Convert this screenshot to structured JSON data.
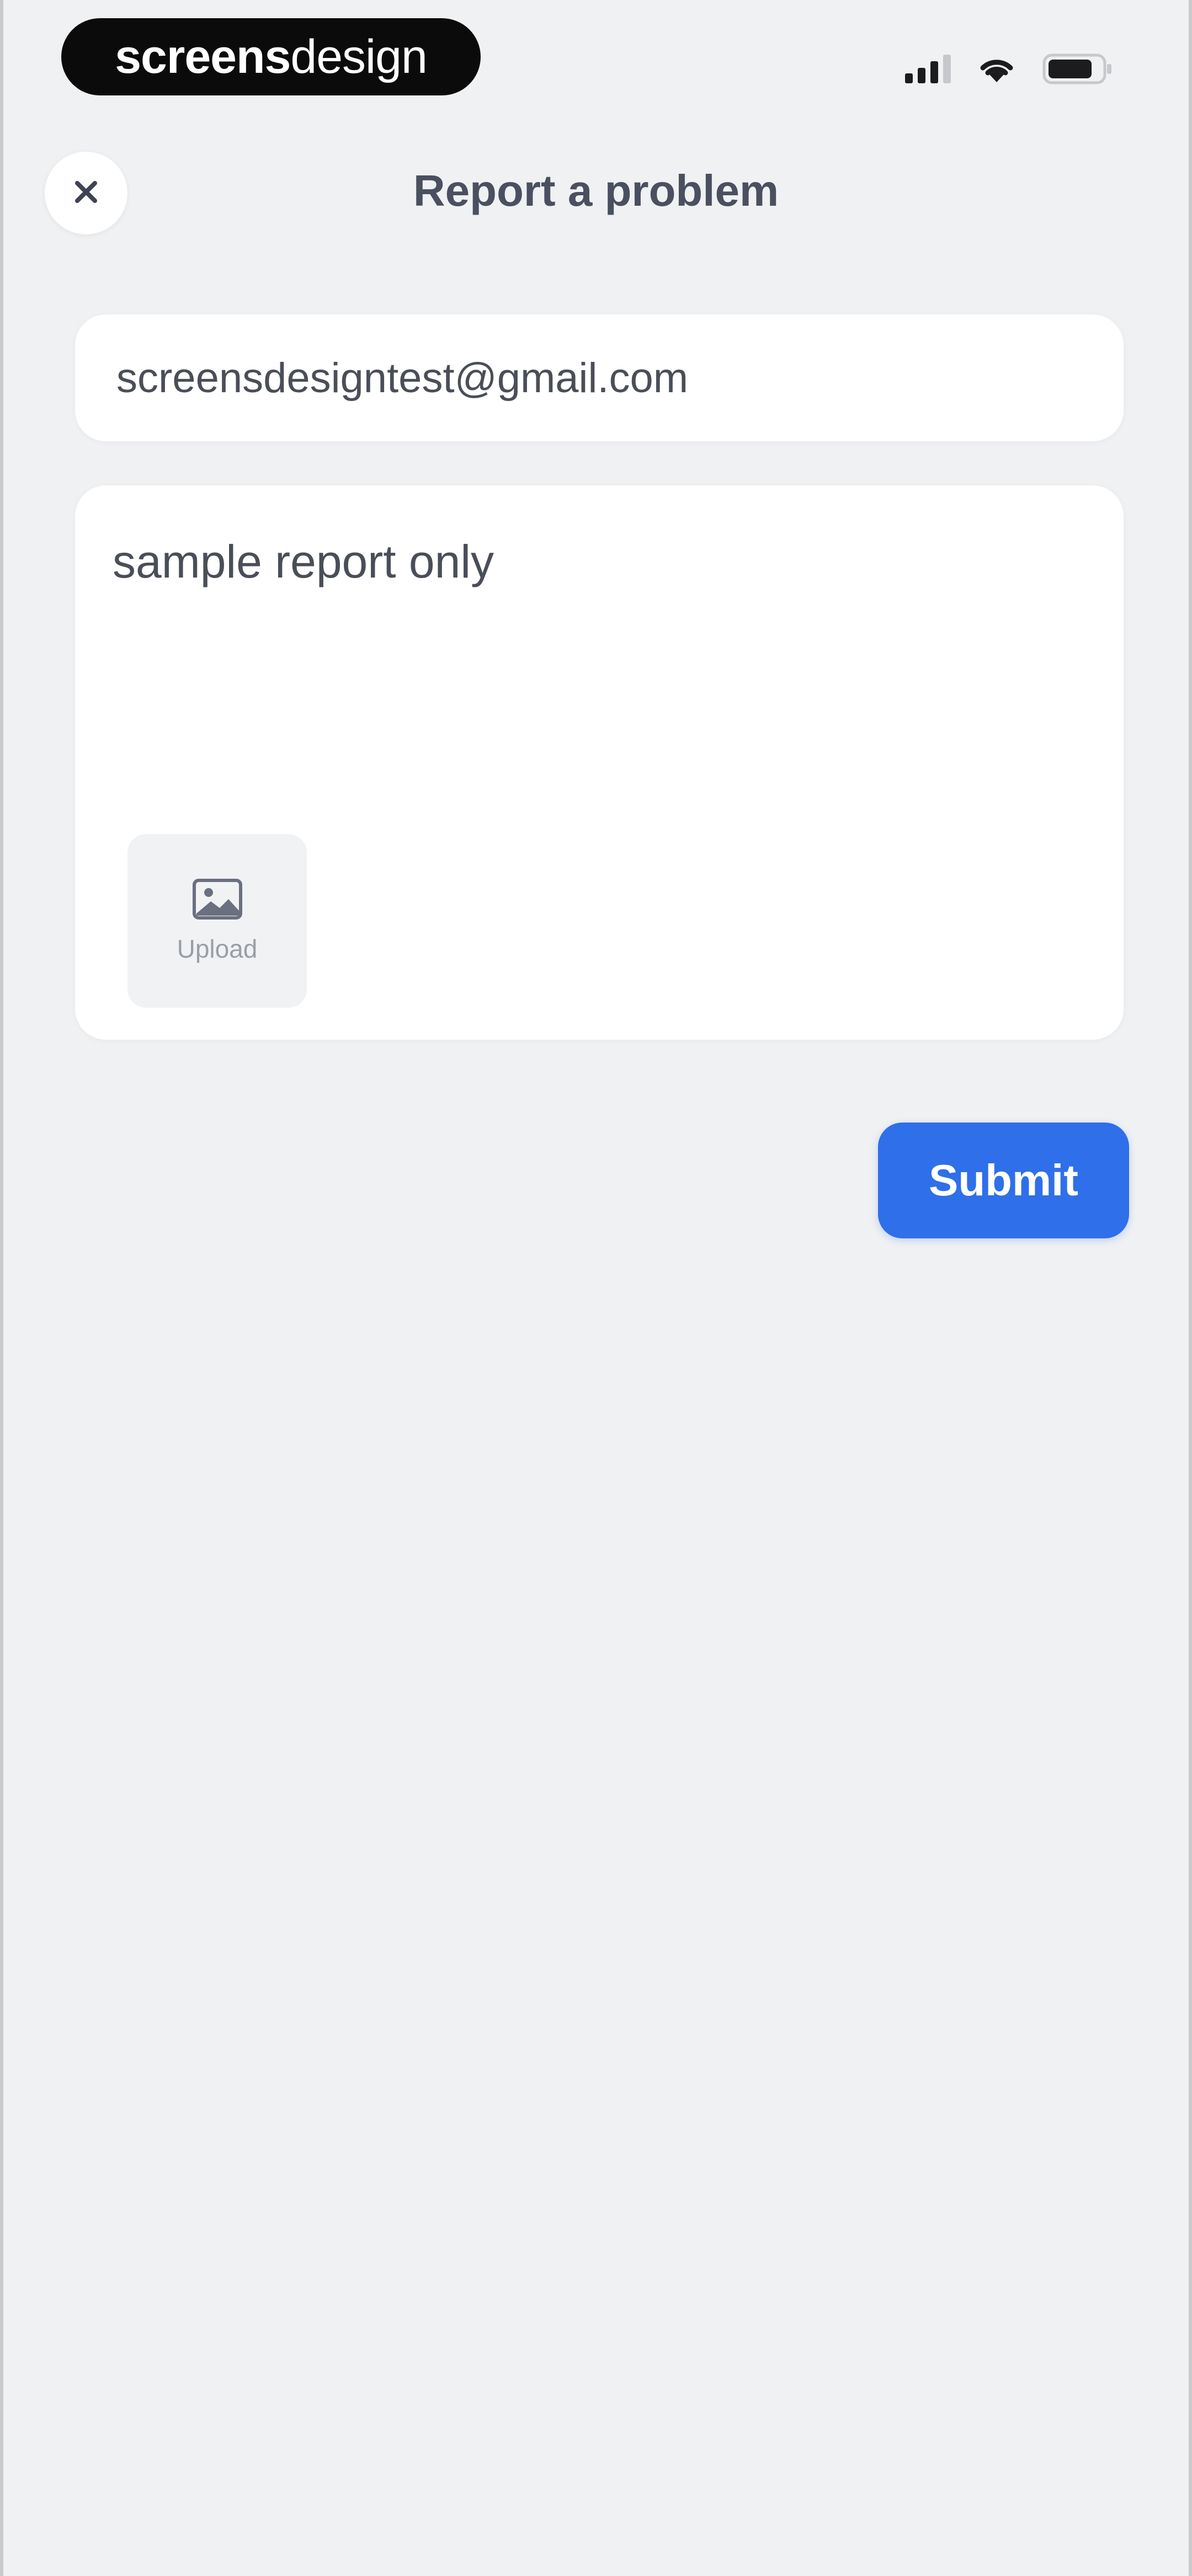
{
  "status_bar": {
    "brand_bold": "screens",
    "brand_light": "design",
    "icons": [
      "signal-icon",
      "wifi-icon",
      "battery-icon"
    ]
  },
  "header": {
    "close_icon": "close-icon",
    "title": "Report a problem"
  },
  "form": {
    "email_value": "screensdesigntest@gmail.com",
    "report_value": "sample report only",
    "upload_label": "Upload",
    "upload_icon": "image-icon",
    "submit_label": "Submit"
  },
  "colors": {
    "background": "#f0f1f3",
    "accent": "#2f6fe9",
    "card": "#ffffff",
    "title_text": "#4a5060"
  }
}
